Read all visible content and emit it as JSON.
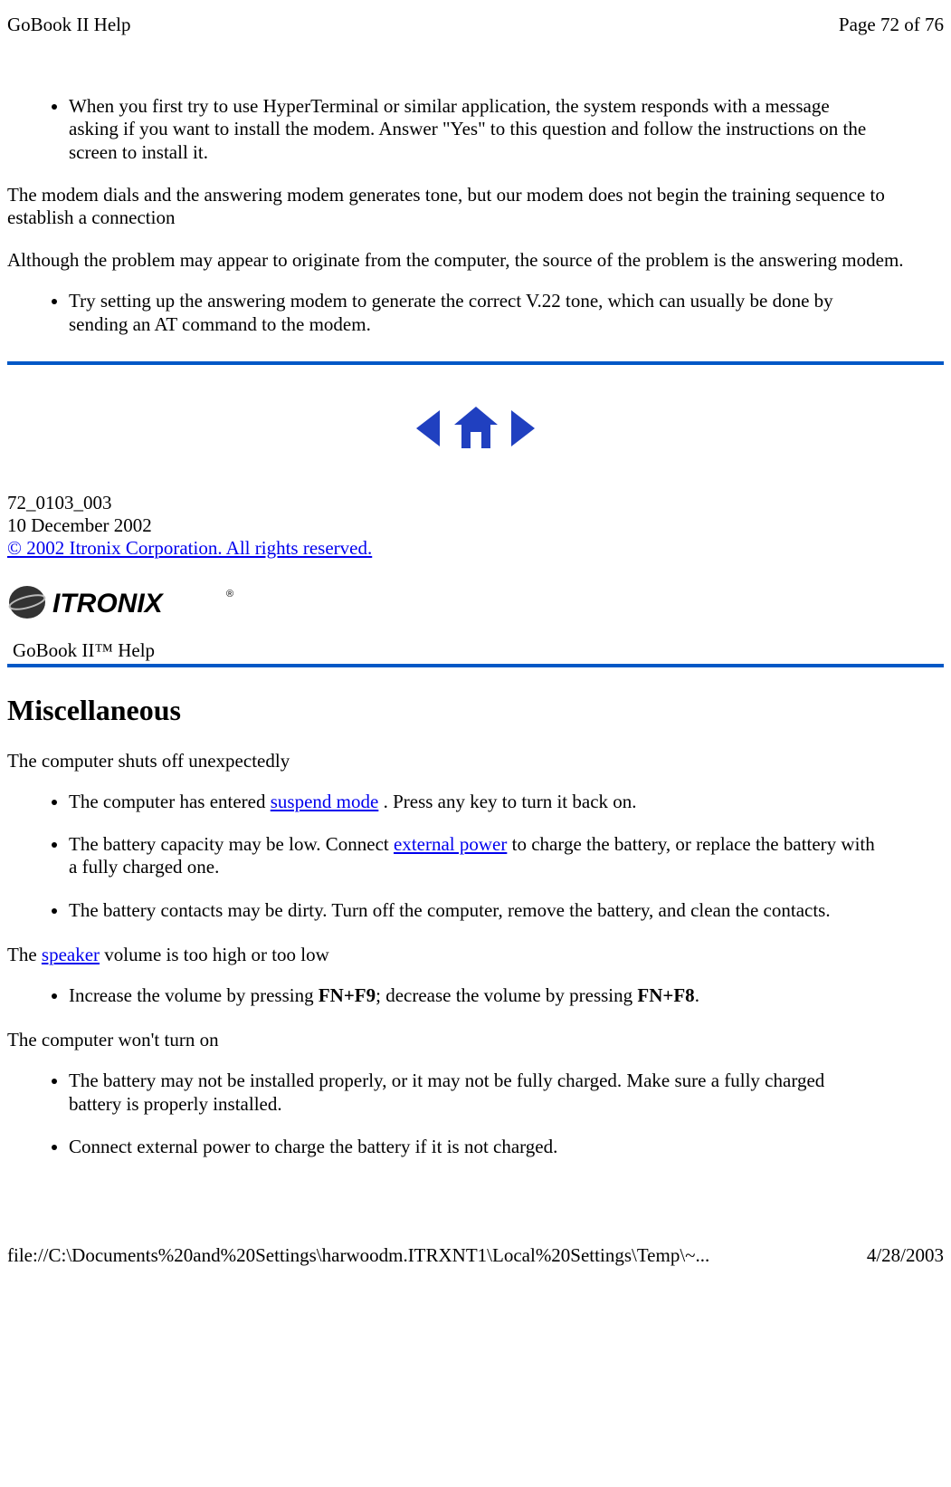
{
  "header": {
    "title": "GoBook II Help",
    "page_indicator": "Page 72 of 76"
  },
  "section1": {
    "bullet1": "When you first try to use HyperTerminal or similar application, the system responds with a message asking if you want to install the modem. Answer \"Yes\" to this question and follow the instructions on the screen to install it.",
    "para1": "The modem dials and the answering modem generates tone, but our modem does not begin the training sequence to establish a connection",
    "para2": "Although the problem may appear to originate from the computer, the source of the problem is the answering modem.",
    "bullet2": "Try setting up the answering modem to generate the correct V.22 tone, which can usually be done by sending an AT command to the modem."
  },
  "docinfo": {
    "id": "72_0103_003",
    "date": "10 December 2002",
    "copyright": "© 2002 Itronix Corporation.  All rights reserved."
  },
  "brand": {
    "help_label": "GoBook II™ Help"
  },
  "misc": {
    "heading": "Miscellaneous",
    "p1": "The computer shuts off unexpectedly",
    "b1_pre": "The computer has entered ",
    "b1_link": "suspend mode",
    "b1_post": " . Press any key to turn it back on.",
    "b2_pre": "The battery capacity may be low. Connect ",
    "b2_link": "external power",
    "b2_post": " to charge the battery, or replace the battery with a fully charged one.",
    "b3": "The battery contacts may be dirty.  Turn off the computer, remove the battery, and clean the contacts.",
    "p2_pre": "The ",
    "p2_link": "speaker",
    "p2_post": " volume is too high or too low",
    "b4_pre": "Increase the volume by pressing ",
    "b4_bold1": "FN+F9",
    "b4_mid": "; decrease the volume by pressing ",
    "b4_bold2": "FN+F8",
    "b4_post": ".",
    "p3": "The computer won't turn on",
    "b5": "The battery may not be installed properly, or it may not be fully charged. Make sure a fully charged battery is properly installed.",
    "b6": "Connect external power to charge the battery if it is not charged."
  },
  "footer": {
    "path": "file://C:\\Documents%20and%20Settings\\harwoodm.ITRXNT1\\Local%20Settings\\Temp\\~...",
    "date": "4/28/2003"
  }
}
